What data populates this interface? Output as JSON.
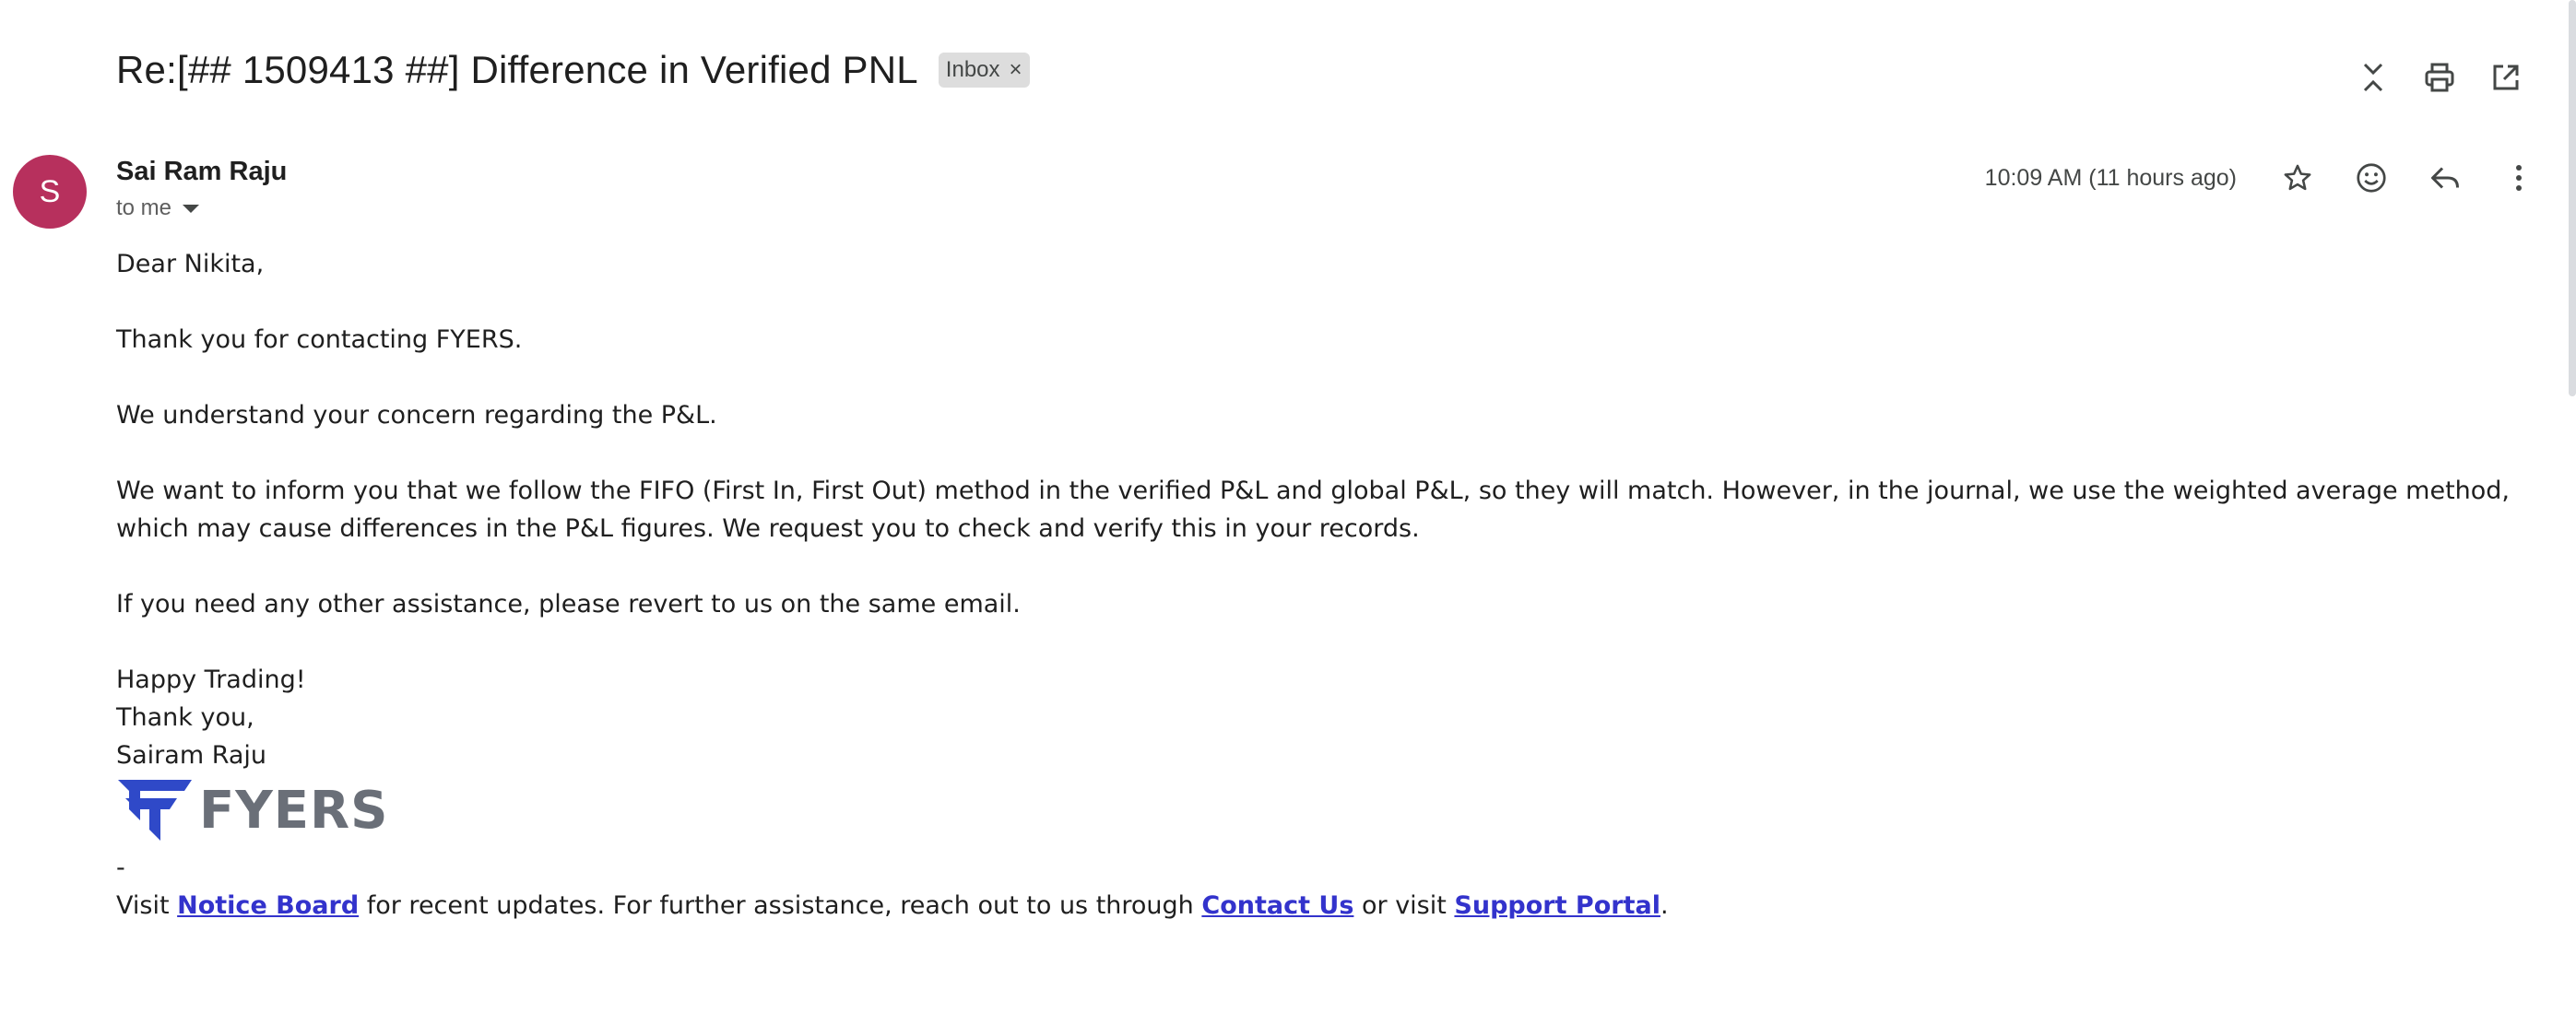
{
  "email": {
    "subject": "Re:[## 1509413 ##] Difference in Verified PNL",
    "label": "Inbox",
    "label_remove": "×",
    "sender": {
      "initial": "S",
      "name": "Sai Ram Raju",
      "recipient": "to me",
      "avatar_color": "#b7305d"
    },
    "timestamp": "10:09 AM (11 hours ago)"
  },
  "body": {
    "greeting": "Dear Nikita,",
    "thanks": "Thank you for contacting FYERS.",
    "understand": "We understand your concern regarding the P&L.",
    "para1_line1": "We want to inform you that we follow the FIFO (First In, First Out) method in the verified P&L and global P&L, so they will match. However, in the journal, we use the weighted average method,",
    "para1_line2": "which may cause differences in the P&L figures. We request you to check and verify this in your records.",
    "assistance": "If you need any other assistance, please revert to us on the same email.",
    "signoff1": "Happy Trading!",
    "signoff2": "Thank you,",
    "signature": "Sairam Raju",
    "logo_text": "FYERS",
    "dash": "-",
    "footer_prefix": "Visit ",
    "link_notice": "Notice Board",
    "footer_middle": " for recent updates. For further assistance, reach out to us through ",
    "link_contact": "Contact Us",
    "footer_or": " or visit ",
    "link_support": "Support Portal",
    "footer_end": "."
  },
  "icons": {
    "top": [
      "expand-collapse-icon",
      "print-icon",
      "open-new-window-icon"
    ],
    "meta": [
      "star-icon",
      "emoji-icon",
      "reply-icon",
      "more-vert-icon"
    ]
  },
  "colors": {
    "link": "#3333cc",
    "logo_blue": "#2f49c8",
    "logo_gray": "#6a6f78"
  }
}
